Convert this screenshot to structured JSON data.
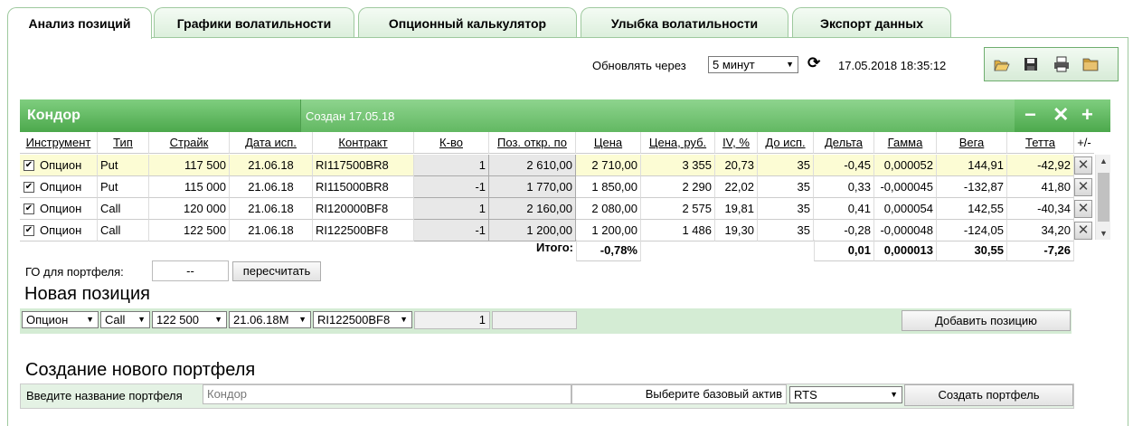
{
  "tabs": [
    {
      "label": "Анализ позиций",
      "active": true
    },
    {
      "label": "Графики волатильности",
      "active": false
    },
    {
      "label": "Опционный калькулятор",
      "active": false
    },
    {
      "label": "Улыбка волатильности",
      "active": false
    },
    {
      "label": "Экспорт данных",
      "active": false
    }
  ],
  "refresh": {
    "label": "Обновлять через",
    "interval": "5 минут",
    "timestamp": "17.05.2018 18:35:12"
  },
  "toolbar": {
    "icons": [
      "open-folder-icon",
      "save-icon",
      "print-icon",
      "folder-icon"
    ]
  },
  "portfolio": {
    "title": "Кондор",
    "created": "Создан 17.05.18",
    "header_actions": [
      "−",
      "✕",
      "+"
    ]
  },
  "table": {
    "headers": [
      "Инструмент",
      "Тип",
      "Страйк",
      "Дата исп.",
      "Контракт",
      "К-во",
      "Поз. откр. по",
      "Цена",
      "Цена, руб.",
      "IV, %",
      "До исп.",
      "Дельта",
      "Гамма",
      "Вега",
      "Тетта",
      "+/-"
    ],
    "rows": [
      [
        "Опцион",
        "Put",
        "117 500",
        "21.06.18",
        "RI117500BR8",
        "1",
        "2 610,00",
        "2 710,00",
        "3 355",
        "20,73",
        "35",
        "-0,45",
        "0,000052",
        "144,91",
        "-42,92"
      ],
      [
        "Опцион",
        "Put",
        "115 000",
        "21.06.18",
        "RI115000BR8",
        "-1",
        "1 770,00",
        "1 850,00",
        "2 290",
        "22,02",
        "35",
        "0,33",
        "-0,000045",
        "-132,87",
        "41,80"
      ],
      [
        "Опцион",
        "Call",
        "120 000",
        "21.06.18",
        "RI120000BF8",
        "1",
        "2 160,00",
        "2 080,00",
        "2 575",
        "19,81",
        "35",
        "0,41",
        "0,000054",
        "142,55",
        "-40,34"
      ],
      [
        "Опцион",
        "Call",
        "122 500",
        "21.06.18",
        "RI122500BF8",
        "-1",
        "1 200,00",
        "1 200,00",
        "1 486",
        "19,30",
        "35",
        "-0,28",
        "-0,000048",
        "-124,05",
        "34,20"
      ]
    ],
    "checked": [
      true,
      true,
      true,
      true
    ],
    "totals": {
      "label": "Итого:",
      "pct": "-0,78%",
      "delta": "0,01",
      "gamma": "0,000013",
      "vega": "30,55",
      "theta": "-7,26"
    }
  },
  "margin": {
    "label": "ГО для портфеля:",
    "value": "--",
    "button": "пересчитать"
  },
  "new_position": {
    "title": "Новая позиция",
    "instrument": "Опцион",
    "type": "Call",
    "strike": "122 500",
    "date": "21.06.18М",
    "contract": "RI122500BF8",
    "qty": "1",
    "button": "Добавить позицию"
  },
  "new_portfolio": {
    "title": "Создание нового портфеля",
    "name_label": "Введите название портфеля",
    "name_placeholder": "Кондор",
    "asset_label": "Выберите базовый актив",
    "asset": "RTS",
    "button": "Создать портфель"
  },
  "colors": {
    "green_dark": "#4ca84c",
    "green_light": "#8ed48e",
    "highlight": "#fcfcd4"
  }
}
